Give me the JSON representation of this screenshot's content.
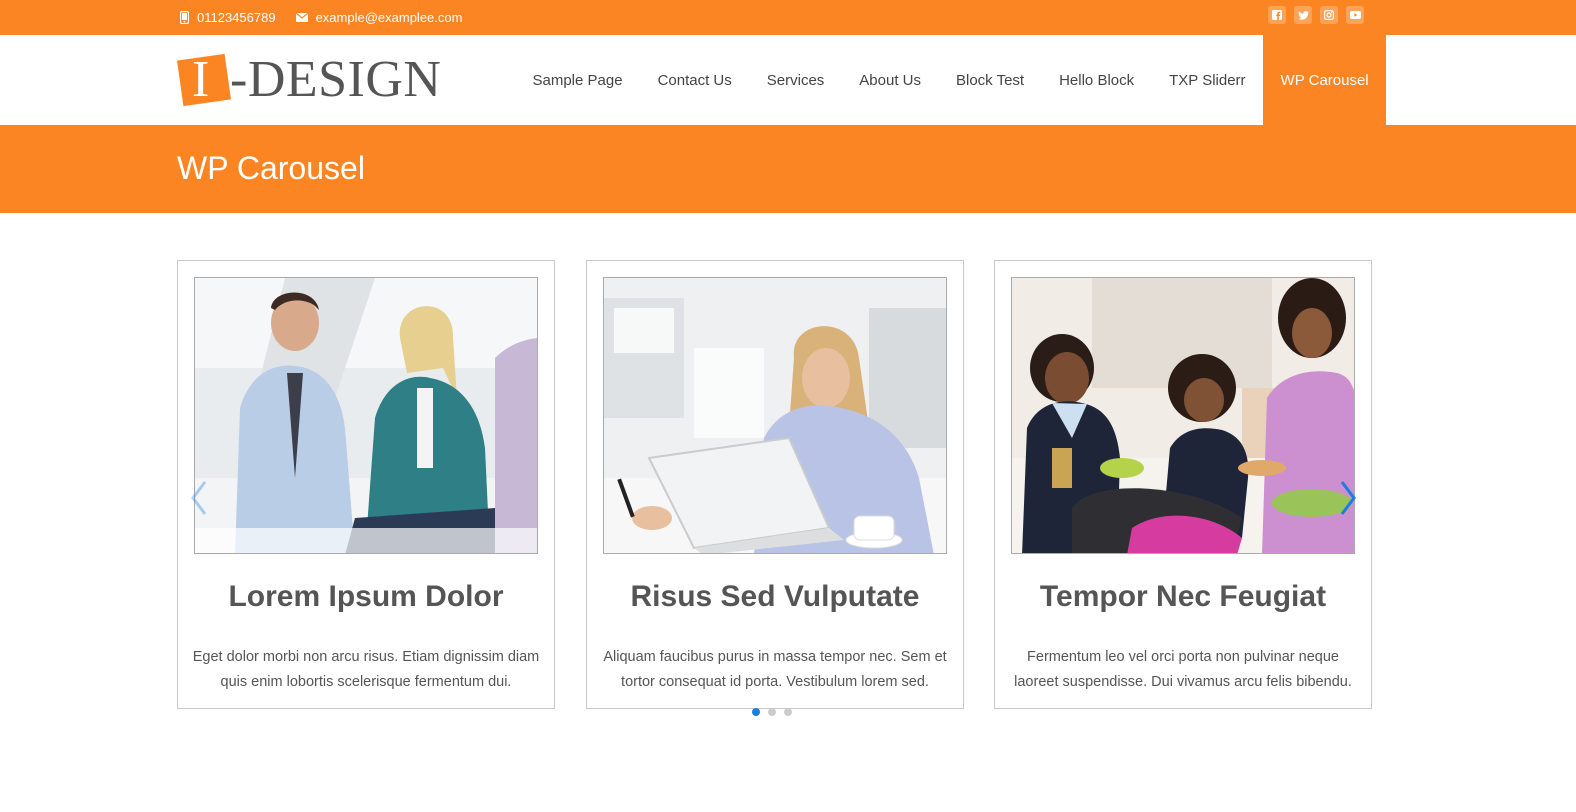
{
  "topbar": {
    "phone": "01123456789",
    "email": "example@examplee.com",
    "social": [
      "facebook-icon",
      "twitter-icon",
      "instagram-icon",
      "youtube-icon"
    ]
  },
  "logo": {
    "mark_letter": "I",
    "text": "-DESIGN"
  },
  "nav": {
    "items": [
      {
        "label": "Sample Page"
      },
      {
        "label": "Contact Us"
      },
      {
        "label": "Services"
      },
      {
        "label": "About Us"
      },
      {
        "label": "Block Test"
      },
      {
        "label": "Hello Block"
      },
      {
        "label": "TXP Sliderr"
      },
      {
        "label": "WP Carousel",
        "active": true
      }
    ]
  },
  "page": {
    "title": "WP Carousel"
  },
  "carousel": {
    "slides": [
      {
        "title": "Lorem Ipsum Dolor",
        "text": "Eget dolor morbi non arcu risus. Etiam dignissim diam quis enim lobortis scelerisque fermentum dui."
      },
      {
        "title": "Risus Sed Vulputate",
        "text": "Aliquam faucibus purus in massa tempor nec. Sem et tortor consequat id porta. Vestibulum lorem sed."
      },
      {
        "title": "Tempor Nec Feugiat",
        "text": "Fermentum leo vel orci porta non pulvinar neque laoreet suspendisse. Dui vivamus arcu felis bibendu."
      }
    ],
    "dots_count": 3,
    "active_dot": 0
  },
  "colors": {
    "brand": "#fb8523",
    "dot_active": "#1a7fe0",
    "arrow": "#1a7fe0"
  }
}
